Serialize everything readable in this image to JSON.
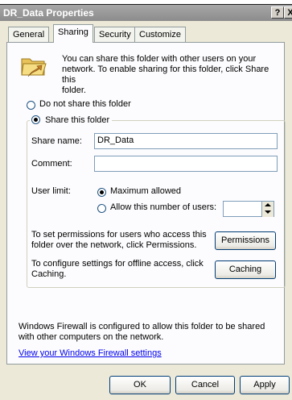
{
  "window": {
    "title": "DR_Data Properties",
    "help_button": "?",
    "close_button": "X"
  },
  "tabs": [
    {
      "label": "General"
    },
    {
      "label": "Sharing"
    },
    {
      "label": "Security"
    },
    {
      "label": "Customize"
    }
  ],
  "sharing": {
    "intro_text_line1": "You can share this folder with other users on your",
    "intro_text_line2": "network.  To enable sharing for this folder, click Share this",
    "intro_text_line3": "folder.",
    "do_not_share_label": "Do not share this folder",
    "share_label": "Share this folder",
    "share_name_label": "Share name:",
    "share_name_value": "DR_Data",
    "comment_label": "Comment:",
    "comment_value": "",
    "user_limit_label": "User limit:",
    "maximum_allowed_label": "Maximum allowed",
    "allow_number_label": "Allow this number of users:",
    "user_number_value": "",
    "permissions_text_line1": "To set permissions for users who access this",
    "permissions_text_line2": "folder over the network, click Permissions.",
    "permissions_button": "Permissions",
    "caching_text_line1": "To configure settings for offline access, click",
    "caching_text_line2": "Caching.",
    "caching_button": "Caching",
    "firewall_text_line1": "Windows Firewall is configured to allow this folder to be shared",
    "firewall_text_line2": "with other computers on the network.",
    "firewall_link": "View your Windows Firewall settings"
  },
  "footer": {
    "ok_button": "OK",
    "cancel_button": "Cancel",
    "apply_button": "Apply"
  }
}
